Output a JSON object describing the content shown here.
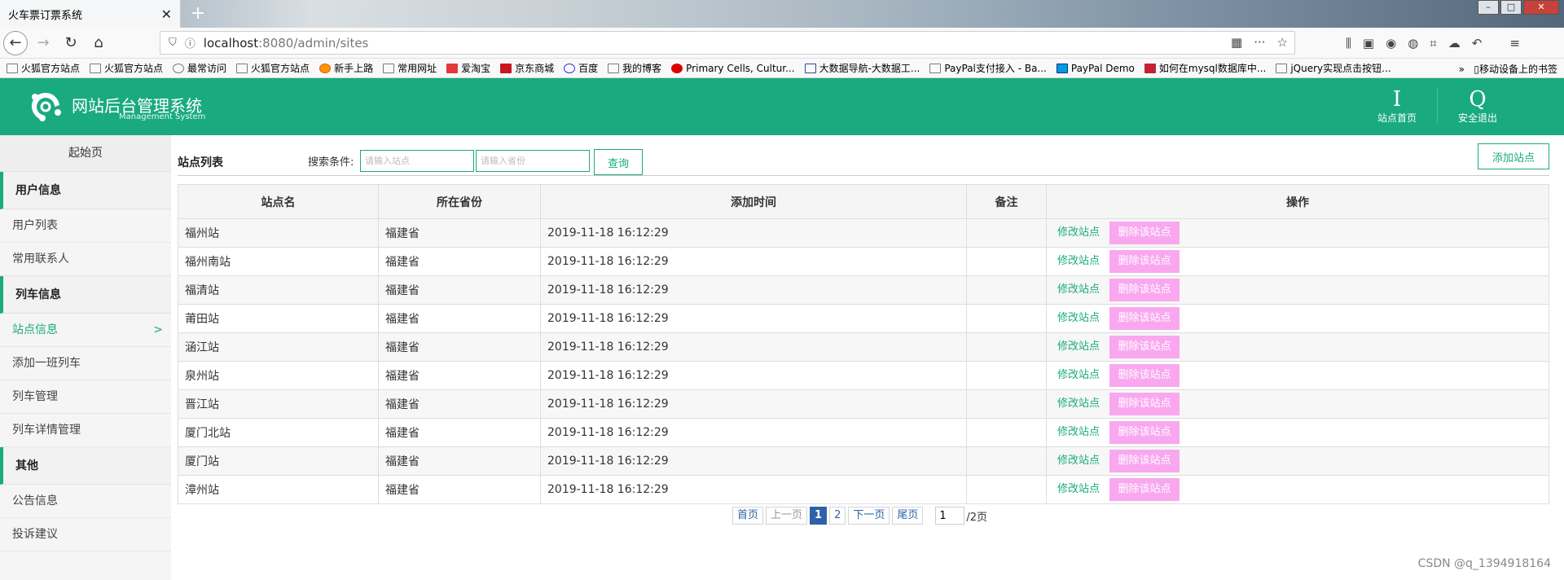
{
  "browser": {
    "tab_title": "火车票订票系统",
    "tab_close": "✕",
    "new_tab": "+",
    "url_host": "localhost",
    "url_rest": ":8080/admin/sites",
    "bookmarks": [
      "火狐官方站点",
      "火狐官方站点",
      "最常访问",
      "火狐官方站点",
      "新手上路",
      "常用网址",
      "爱淘宝",
      "京东商城",
      "百度",
      "我的博客",
      "Primary Cells, Cultur...",
      "大数据导航-大数据工...",
      "PayPal支付接入 - Ba...",
      "PayPal Demo",
      "如何在mysql数据库中...",
      "jQuery实现点击按钮..."
    ],
    "bookmarks_more": "移动设备上的书签"
  },
  "header": {
    "title": "网站后台管理系统",
    "subtitle": "Management System",
    "home_glyph": "I",
    "home_label": "站点首页",
    "logout_glyph": "Q",
    "logout_label": "安全退出",
    "bg_color": "#1aaa80"
  },
  "sidebar": {
    "start": "起始页",
    "groups": [
      {
        "title": "用户信息",
        "items": [
          "用户列表",
          "常用联系人"
        ]
      },
      {
        "title": "列车信息",
        "items": [
          "站点信息",
          "添加一班列车",
          "列车管理",
          "列车详情管理"
        ]
      },
      {
        "title": "其他",
        "items": [
          "公告信息",
          "投诉建议"
        ]
      }
    ],
    "active_item": "站点信息",
    "active_arrow": ">"
  },
  "main": {
    "title": "站点列表",
    "search_label": "搜索条件:",
    "station_placeholder": "请输入站点",
    "province_placeholder": "请输入省份",
    "search_button": "查询",
    "add_button": "添加站点",
    "columns": [
      "站点名",
      "所在省份",
      "添加时间",
      "备注",
      "操作"
    ],
    "rows": [
      {
        "name": "福州站",
        "province": "福建省",
        "time": "2019-11-18 16:12:29",
        "note": ""
      },
      {
        "name": "福州南站",
        "province": "福建省",
        "time": "2019-11-18 16:12:29",
        "note": ""
      },
      {
        "name": "福清站",
        "province": "福建省",
        "time": "2019-11-18 16:12:29",
        "note": ""
      },
      {
        "name": "莆田站",
        "province": "福建省",
        "time": "2019-11-18 16:12:29",
        "note": ""
      },
      {
        "name": "涵江站",
        "province": "福建省",
        "time": "2019-11-18 16:12:29",
        "note": ""
      },
      {
        "name": "泉州站",
        "province": "福建省",
        "time": "2019-11-18 16:12:29",
        "note": ""
      },
      {
        "name": "晋江站",
        "province": "福建省",
        "time": "2019-11-18 16:12:29",
        "note": ""
      },
      {
        "name": "厦门北站",
        "province": "福建省",
        "time": "2019-11-18 16:12:29",
        "note": ""
      },
      {
        "name": "厦门站",
        "province": "福建省",
        "time": "2019-11-18 16:12:29",
        "note": ""
      },
      {
        "name": "漳州站",
        "province": "福建省",
        "time": "2019-11-18 16:12:29",
        "note": ""
      }
    ],
    "edit_label": "修改站点",
    "delete_label": "删除该站点",
    "delete_color": "#f9a8f0"
  },
  "pager": {
    "first": "首页",
    "prev": "上一页",
    "pages": [
      "1",
      "2"
    ],
    "current": "1",
    "next": "下一页",
    "last": "尾页",
    "input_value": "1",
    "total": "/2页"
  },
  "watermark": "CSDN @q_1394918164"
}
